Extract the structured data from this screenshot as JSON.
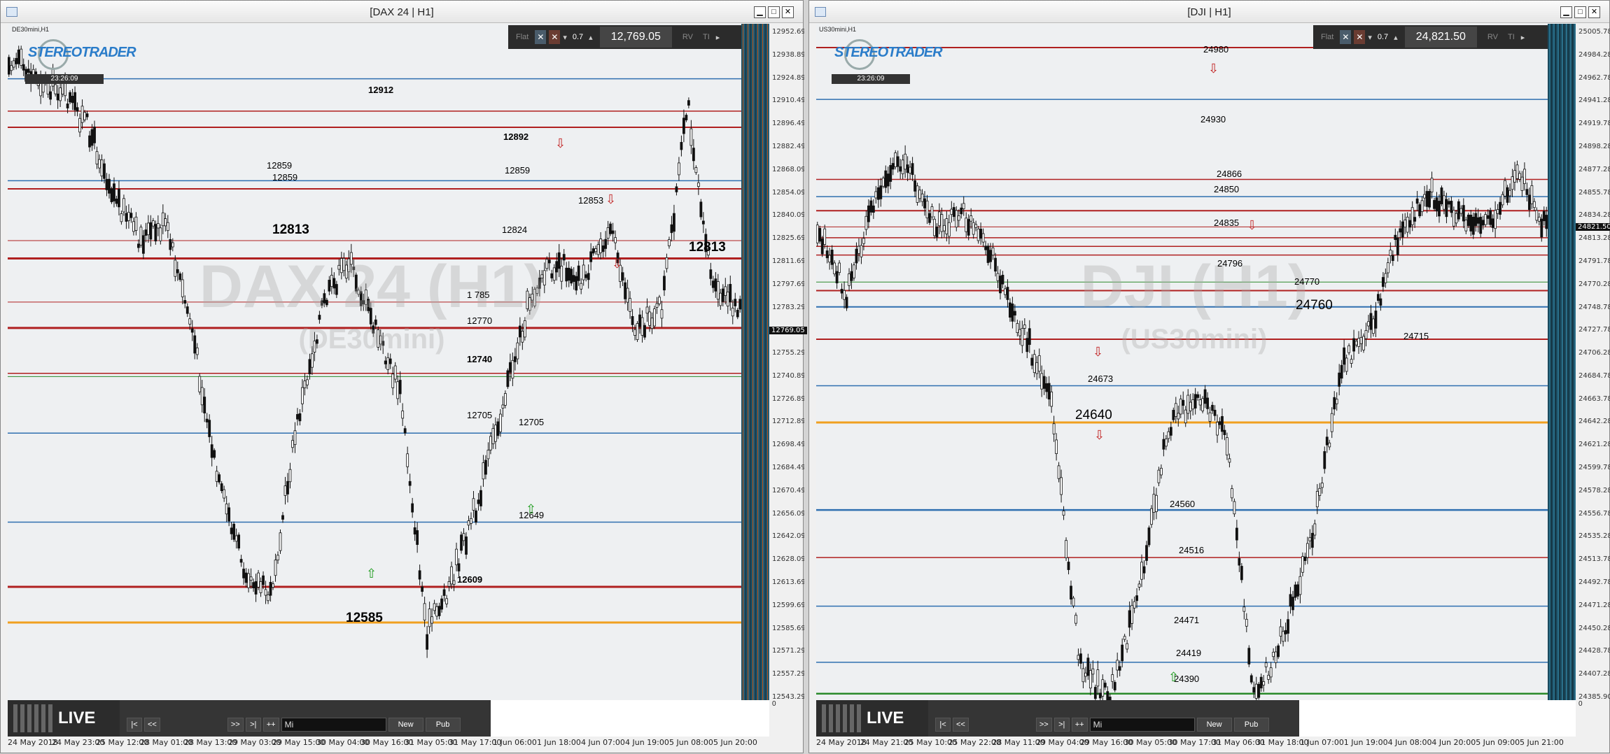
{
  "left": {
    "title": "[DAX 24 | H1]",
    "symbol_label": "DE30mini,H1",
    "watermark_main": "DAX 24 (H1)",
    "watermark_sub": "(DE30mini)",
    "clock": "23:26:09",
    "logo_text": "STEREOTRADER",
    "toolbar": {
      "mode": "Flat",
      "lots": "0.7",
      "price": "12,769.05",
      "rv": "RV",
      "ti": "TI"
    },
    "current_price_tag": "12769.05",
    "axis_prices": [
      "12952.69",
      "12938.89",
      "12924.89",
      "12910.49",
      "12896.49",
      "12882.49",
      "12868.09",
      "12854.09",
      "12840.09",
      "12825.69",
      "12811.69",
      "12797.69",
      "12783.29",
      "12769.05",
      "12755.29",
      "12740.89",
      "12726.89",
      "12712.89",
      "12698.49",
      "12684.49",
      "12670.49",
      "12656.09",
      "12642.09",
      "12628.09",
      "12613.69",
      "12599.69",
      "12585.69",
      "12571.29",
      "12557.29",
      "12543.29"
    ],
    "dates": [
      "24 May 2018",
      "24 May 23:00",
      "25 May 12:00",
      "28 May 01:00",
      "28 May 13:00",
      "29 May 03:00",
      "29 May 15:00",
      "30 May 04:00",
      "30 May 16:00",
      "31 May 05:00",
      "31 May 17:00",
      "1 Jun 06:00",
      "1 Jun 18:00",
      "4 Jun 07:00",
      "4 Jun 19:00",
      "5 Jun 08:00",
      "5 Jun 20:00"
    ],
    "levels": [
      {
        "text": "12912",
        "bold": true,
        "big": false
      },
      {
        "text": "12892",
        "bold": true,
        "big": false
      },
      {
        "text": "12859",
        "bold": false,
        "big": false
      },
      {
        "text": "12859",
        "bold": false,
        "big": false
      },
      {
        "text": "12859",
        "bold": false,
        "big": false
      },
      {
        "text": "12853",
        "bold": false,
        "big": false
      },
      {
        "text": "12824",
        "bold": false,
        "big": false
      },
      {
        "text": "12813",
        "bold": true,
        "big": true
      },
      {
        "text": "12813",
        "bold": true,
        "big": true
      },
      {
        "text": "1 785",
        "bold": false,
        "big": false
      },
      {
        "text": "12770",
        "bold": false,
        "big": false
      },
      {
        "text": "12740",
        "bold": true,
        "big": false
      },
      {
        "text": "12705",
        "bold": false,
        "big": false
      },
      {
        "text": "12705",
        "bold": false,
        "big": false
      },
      {
        "text": "12649",
        "bold": false,
        "big": false
      },
      {
        "text": "12609",
        "bold": true,
        "big": false
      },
      {
        "text": "12585",
        "bold": true,
        "big": true
      }
    ],
    "lines": [
      {
        "price": 12924,
        "color": "#2f6fb0",
        "w": 1.5
      },
      {
        "price": 12904,
        "color": "#b02020",
        "w": 1.5
      },
      {
        "price": 12894,
        "color": "#b02020",
        "w": 2
      },
      {
        "price": 12861,
        "color": "#2f6fb0",
        "w": 1.5
      },
      {
        "price": 12856,
        "color": "#b02020",
        "w": 2
      },
      {
        "price": 12824,
        "color": "#b02020",
        "w": 1
      },
      {
        "price": 12813,
        "color": "#b02020",
        "w": 3
      },
      {
        "price": 12786,
        "color": "#b02020",
        "w": 1
      },
      {
        "price": 12770,
        "color": "#b02020",
        "w": 3
      },
      {
        "price": 12742,
        "color": "#b02020",
        "w": 1.5
      },
      {
        "price": 12740,
        "color": "#2a8a2a",
        "w": 1
      },
      {
        "price": 12705,
        "color": "#2f6fb0",
        "w": 1.5
      },
      {
        "price": 12650,
        "color": "#2f6fb0",
        "w": 1.5
      },
      {
        "price": 12610,
        "color": "#b02020",
        "w": 3
      },
      {
        "price": 12588,
        "color": "#f0a020",
        "w": 3
      }
    ],
    "bottom": {
      "live": "LIVE",
      "first": "|<",
      "prev": "<<",
      "next": ">>",
      "last": ">|",
      "fit": "++",
      "filter": "Mi",
      "new": "New",
      "pub": "Pub",
      "sub_value": "0"
    }
  },
  "right": {
    "title": "[DJI | H1]",
    "symbol_label": "US30mini,H1",
    "watermark_main": "DJI (H1)",
    "watermark_sub": "(US30mini)",
    "clock": "23:26:09",
    "logo_text": "STEREOTRADER",
    "toolbar": {
      "mode": "Flat",
      "lots": "0.7",
      "price": "24,821.50",
      "rv": "RV",
      "ti": "TI"
    },
    "current_price_tag": "24821.50",
    "axis_prices": [
      "25005.78",
      "24984.28",
      "24962.78",
      "24941.28",
      "24919.78",
      "24898.28",
      "24877.28",
      "24855.78",
      "24834.28",
      "24813.28",
      "24791.78",
      "24770.28",
      "24748.78",
      "24727.78",
      "24706.28",
      "24684.78",
      "24663.78",
      "24642.28",
      "24621.28",
      "24599.78",
      "24578.28",
      "24556.78",
      "24535.28",
      "24513.78",
      "24492.78",
      "24471.28",
      "24450.28",
      "24428.78",
      "24407.28",
      "24385.90"
    ],
    "dates": [
      "24 May 2018",
      "24 May 21:00",
      "25 May 10:00",
      "25 May 22:00",
      "28 May 11:00",
      "29 May 04:00",
      "29 May 16:00",
      "30 May 05:00",
      "30 May 17:00",
      "31 May 06:00",
      "31 May 18:00",
      "1 Jun 07:00",
      "1 Jun 19:00",
      "4 Jun 08:00",
      "4 Jun 20:00",
      "5 Jun 09:00",
      "5 Jun 21:00"
    ],
    "levels": [
      {
        "text": "24980",
        "bold": false,
        "big": false
      },
      {
        "text": "24930",
        "bold": false,
        "big": false
      },
      {
        "text": "24866",
        "bold": false,
        "big": false
      },
      {
        "text": "24850",
        "bold": false,
        "big": false
      },
      {
        "text": "24835",
        "bold": false,
        "big": false
      },
      {
        "text": "24796",
        "bold": false,
        "big": false
      },
      {
        "text": "24770",
        "bold": false,
        "big": false
      },
      {
        "text": "24760",
        "bold": false,
        "big": true
      },
      {
        "text": "24715",
        "bold": false,
        "big": false
      },
      {
        "text": "24673",
        "bold": false,
        "big": false
      },
      {
        "text": "24640",
        "bold": false,
        "big": true
      },
      {
        "text": "24560",
        "bold": false,
        "big": false
      },
      {
        "text": "24516",
        "bold": false,
        "big": false
      },
      {
        "text": "24471",
        "bold": false,
        "big": false
      },
      {
        "text": "24419",
        "bold": false,
        "big": false
      },
      {
        "text": "24390",
        "bold": false,
        "big": false
      }
    ],
    "lines": [
      {
        "price": 24988,
        "color": "#b02020",
        "w": 2
      },
      {
        "price": 24940,
        "color": "#2f6fb0",
        "w": 1.5
      },
      {
        "price": 24866,
        "color": "#b02020",
        "w": 1.5
      },
      {
        "price": 24850,
        "color": "#2f6fb0",
        "w": 1.5
      },
      {
        "price": 24837,
        "color": "#b02020",
        "w": 2
      },
      {
        "price": 24822,
        "color": "#b02020",
        "w": 1
      },
      {
        "price": 24812,
        "color": "#b02020",
        "w": 1.5
      },
      {
        "price": 24804,
        "color": "#b02020",
        "w": 1.5
      },
      {
        "price": 24796,
        "color": "#b02020",
        "w": 1.5
      },
      {
        "price": 24771,
        "color": "#2a8a2a",
        "w": 1
      },
      {
        "price": 24763,
        "color": "#b02020",
        "w": 2
      },
      {
        "price": 24748,
        "color": "#2f6fb0",
        "w": 2
      },
      {
        "price": 24718,
        "color": "#b02020",
        "w": 2
      },
      {
        "price": 24675,
        "color": "#2f6fb0",
        "w": 1.5
      },
      {
        "price": 24641,
        "color": "#f0a020",
        "w": 3
      },
      {
        "price": 24560,
        "color": "#2f6fb0",
        "w": 2.5
      },
      {
        "price": 24516,
        "color": "#b02020",
        "w": 1.5
      },
      {
        "price": 24471,
        "color": "#2f6fb0",
        "w": 1.5
      },
      {
        "price": 24419,
        "color": "#2f6fb0",
        "w": 1.5
      },
      {
        "price": 24390,
        "color": "#2a8a2a",
        "w": 2.5
      }
    ],
    "bottom": {
      "live": "LIVE",
      "first": "|<",
      "prev": "<<",
      "next": ">>",
      "last": ">|",
      "fit": "++",
      "filter": "Mi",
      "new": "New",
      "pub": "Pub",
      "sub_value": "0"
    }
  }
}
